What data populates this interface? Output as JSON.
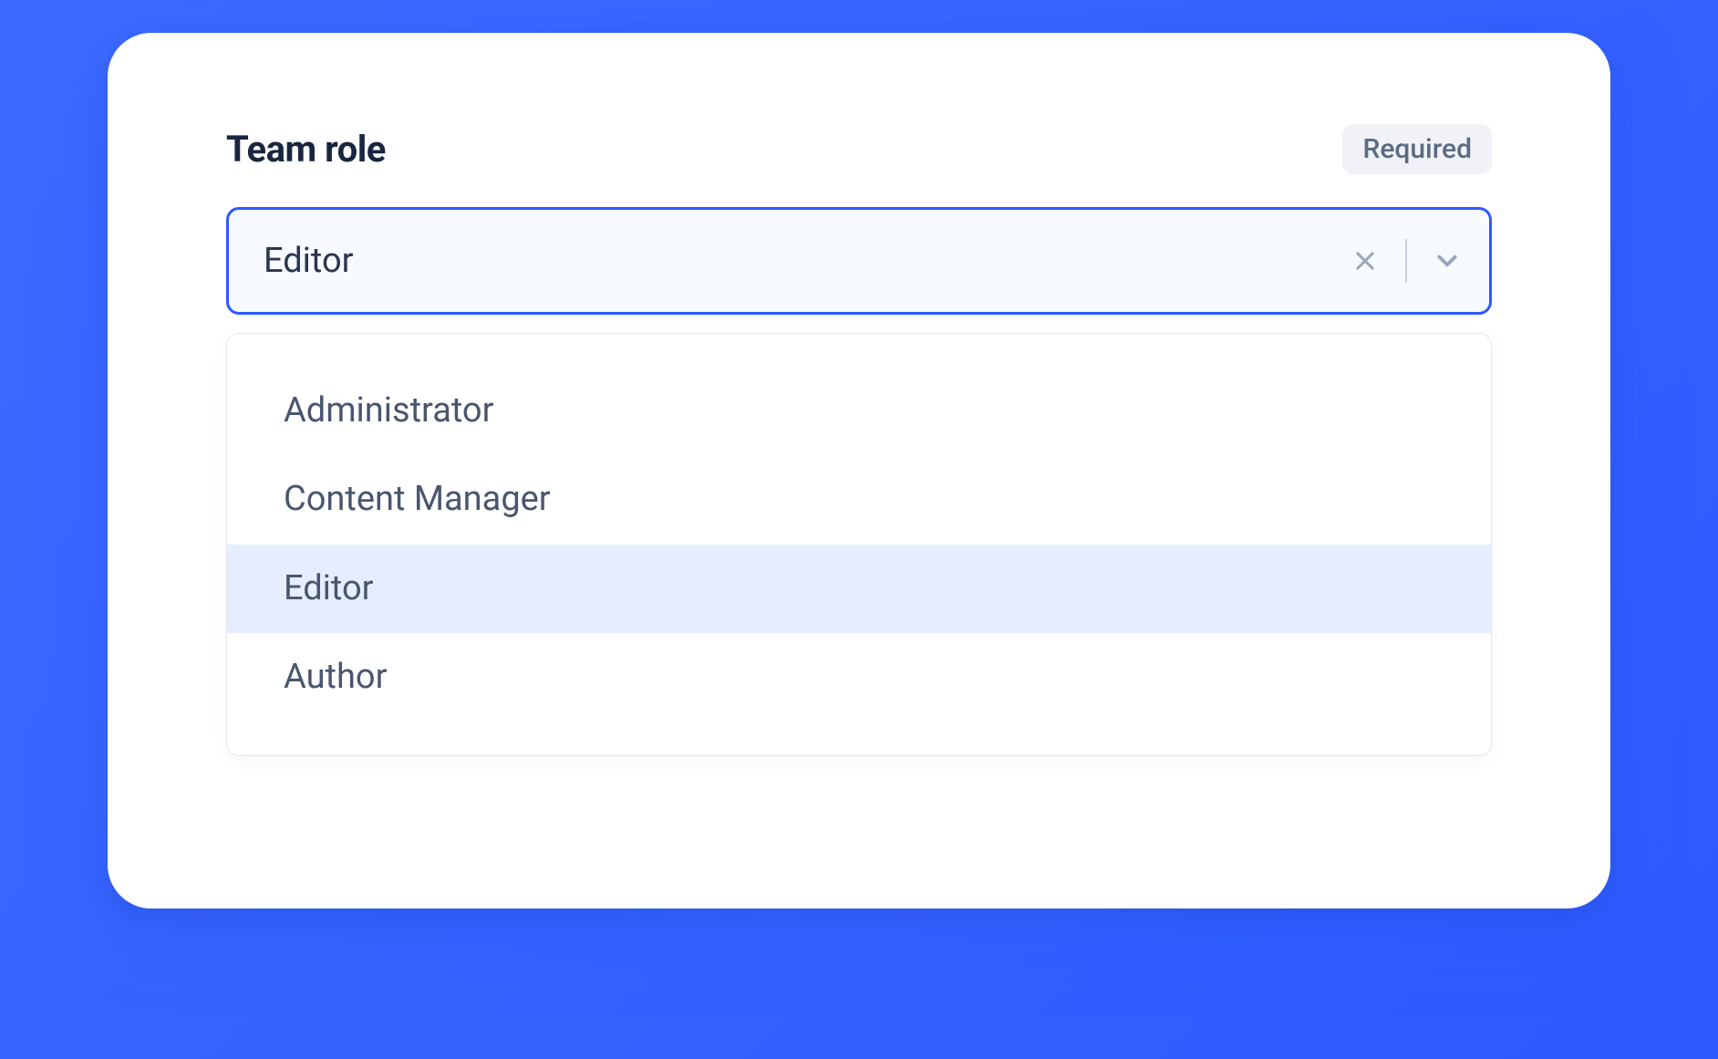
{
  "field": {
    "label": "Team role",
    "badge": "Required",
    "value": "Editor"
  },
  "options": [
    {
      "label": "Administrator",
      "selected": false
    },
    {
      "label": "Content Manager",
      "selected": false
    },
    {
      "label": "Editor",
      "selected": true
    },
    {
      "label": "Author",
      "selected": false
    }
  ],
  "colors": {
    "accent": "#2d5aff",
    "text_primary": "#1a2640",
    "text_secondary": "#4a5670",
    "badge_bg": "#f0f2f7",
    "option_selected_bg": "#e6edff"
  }
}
